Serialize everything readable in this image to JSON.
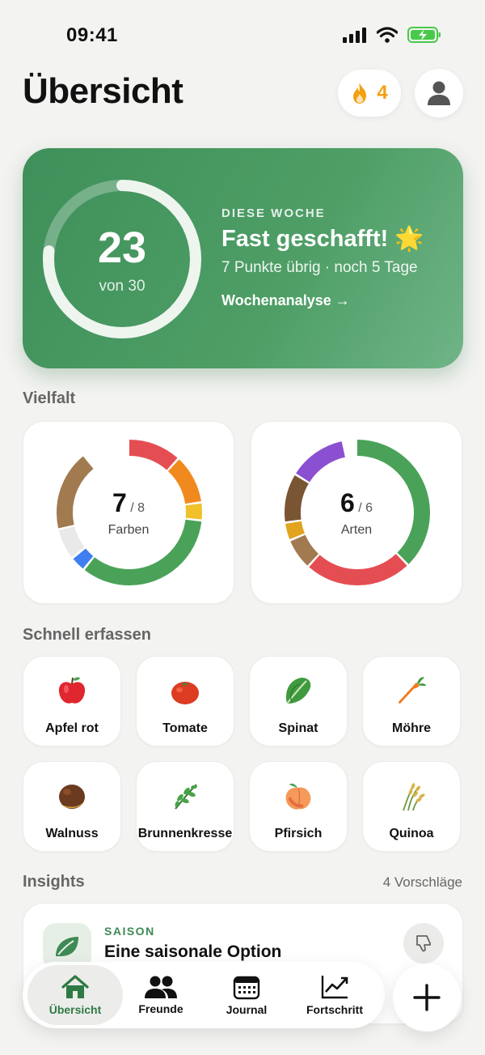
{
  "status_bar": {
    "time": "09:41"
  },
  "header": {
    "title": "Übersicht",
    "streak_count": "4"
  },
  "weekly": {
    "score": "23",
    "of_label": "von 30",
    "progress": 0.767,
    "kicker": "DIESE WOCHE",
    "headline": "Fast geschafft! 🌟",
    "subtitle": "7 Punkte übrig · noch 5 Tage",
    "link_label": "Wochenanalyse →"
  },
  "variety": {
    "section_label": "Vielfalt",
    "colors": {
      "count": "7",
      "total": "/ 8",
      "label": "Farben",
      "segments": [
        {
          "color": "#e44e52",
          "fraction": 0.12
        },
        {
          "color": "#f08a1e",
          "fraction": 0.11
        },
        {
          "color": "#f0c12a",
          "fraction": 0.04
        },
        {
          "color": "#4aa259",
          "fraction": 0.34
        },
        {
          "color": "#3f7ef0",
          "fraction": 0.035
        },
        {
          "color": "#e9e9e9",
          "fraction": 0.07
        },
        {
          "color": "#a27a50",
          "fraction": 0.18
        }
      ]
    },
    "types": {
      "count": "6",
      "total": "/ 6",
      "label": "Arten",
      "segments": [
        {
          "color": "#4aa259",
          "fraction": 0.38
        },
        {
          "color": "#e44e52",
          "fraction": 0.24
        },
        {
          "color": "#a27a50",
          "fraction": 0.07
        },
        {
          "color": "#e2a41e",
          "fraction": 0.04
        },
        {
          "color": "#7a5534",
          "fraction": 0.11
        },
        {
          "color": "#8b4fd1",
          "fraction": 0.13
        }
      ]
    }
  },
  "quick_add": {
    "section_label": "Schnell erfassen",
    "items": [
      {
        "label": "Apfel rot",
        "icon": "apple-icon"
      },
      {
        "label": "Tomate",
        "icon": "tomato-icon"
      },
      {
        "label": "Spinat",
        "icon": "spinach-icon"
      },
      {
        "label": "Möhre",
        "icon": "carrot-icon"
      },
      {
        "label": "Walnuss",
        "icon": "walnut-icon"
      },
      {
        "label": "Brunnenkresse",
        "icon": "herb-icon"
      },
      {
        "label": "Pfirsich",
        "icon": "peach-icon"
      },
      {
        "label": "Quinoa",
        "icon": "grain-icon"
      }
    ]
  },
  "insights": {
    "section_label": "Insights",
    "count_label": "4 Vorschläge",
    "card": {
      "kicker": "SAISON",
      "title": "Eine saisonale Option"
    }
  },
  "tabbar": {
    "tabs": [
      {
        "label": "Übersicht",
        "icon": "home-icon"
      },
      {
        "label": "Freunde",
        "icon": "friends-icon"
      },
      {
        "label": "Journal",
        "icon": "calendar-icon"
      },
      {
        "label": "Fortschritt",
        "icon": "chart-icon"
      }
    ],
    "active": 0
  },
  "colors": {
    "accent": "#3e8a55",
    "streak": "#f2a012"
  }
}
